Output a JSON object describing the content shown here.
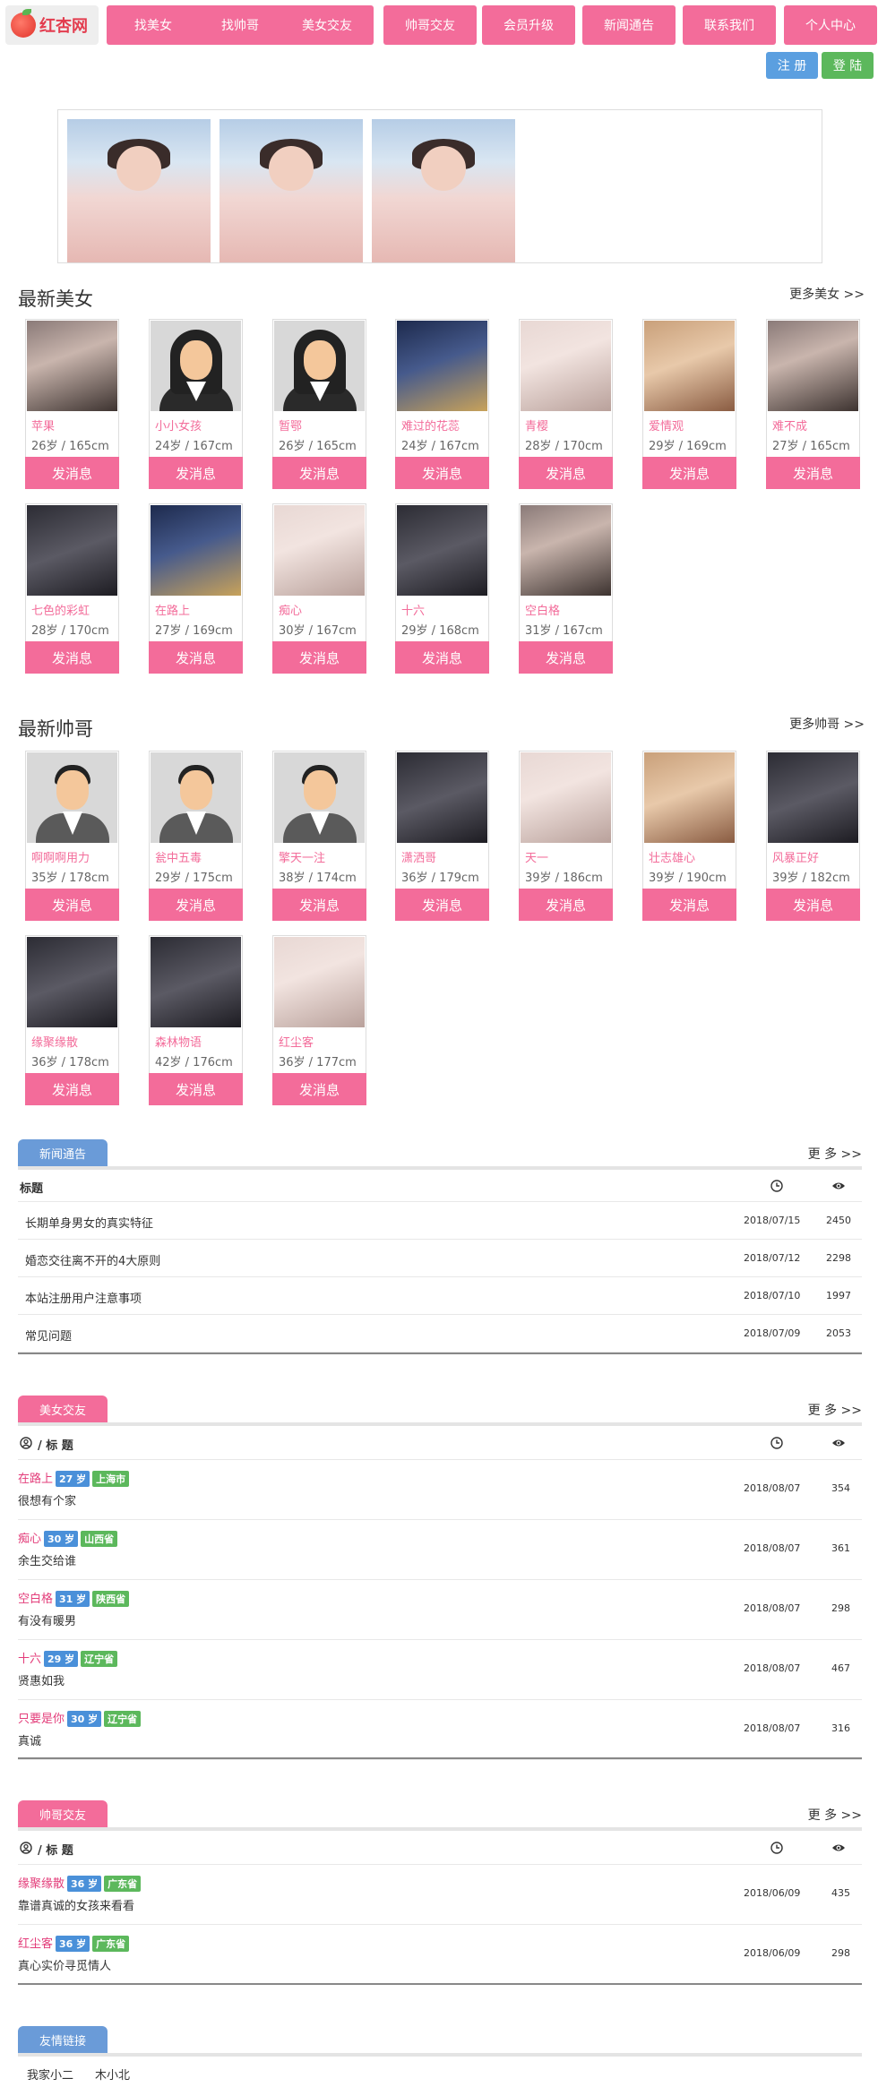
{
  "logo": {
    "text": "红杏网"
  },
  "nav": [
    "找美女",
    "找帅哥",
    "美女交友",
    "帅哥交友",
    "会员升级",
    "新闻通告",
    "联系我们",
    "个人中心"
  ],
  "auth": {
    "register": "注 册",
    "login": "登 陆"
  },
  "sections": {
    "girls": {
      "title": "最新美女",
      "more": "更多美女 >>"
    },
    "boys": {
      "title": "最新帅哥",
      "more": "更多帅哥 >>"
    }
  },
  "msg_label": "发消息",
  "girls": [
    {
      "name": "苹果",
      "info": "26岁 / 165cm",
      "photo": "photo"
    },
    {
      "name": "小小女孩",
      "info": "24岁 / 167cm",
      "photo": "avatar-f"
    },
    {
      "name": "暂鄂",
      "info": "26岁 / 165cm",
      "photo": "avatar-f"
    },
    {
      "name": "难过的花蕊",
      "info": "24岁 / 167cm",
      "photo": "blue"
    },
    {
      "name": "青樱",
      "info": "28岁 / 170cm",
      "photo": "light"
    },
    {
      "name": "爱情观",
      "info": "29岁 / 169cm",
      "photo": "warm"
    },
    {
      "name": "难不成",
      "info": "27岁 / 165cm",
      "photo": "photo"
    },
    {
      "name": "七色的彩虹",
      "info": "28岁 / 170cm",
      "photo": "dark"
    },
    {
      "name": "在路上",
      "info": "27岁 / 169cm",
      "photo": "blue"
    },
    {
      "name": "痴心",
      "info": "30岁 / 167cm",
      "photo": "light"
    },
    {
      "name": "十六",
      "info": "29岁 / 168cm",
      "photo": "dark"
    },
    {
      "name": "空白格",
      "info": "31岁 / 167cm",
      "photo": "photo"
    }
  ],
  "boys": [
    {
      "name": "啊啊啊用力",
      "info": "35岁 / 178cm",
      "photo": "avatar-m"
    },
    {
      "name": "瓮中五毒",
      "info": "29岁 / 175cm",
      "photo": "avatar-m"
    },
    {
      "name": "擎天一注",
      "info": "38岁 / 174cm",
      "photo": "avatar-m"
    },
    {
      "name": "潇洒哥",
      "info": "36岁 / 179cm",
      "photo": "dark"
    },
    {
      "name": "天一",
      "info": "39岁 / 186cm",
      "photo": "light"
    },
    {
      "name": "壮志雄心",
      "info": "39岁 / 190cm",
      "photo": "warm"
    },
    {
      "name": "风暴正好",
      "info": "39岁 / 182cm",
      "photo": "dark"
    },
    {
      "name": "缘聚缘散",
      "info": "36岁 / 178cm",
      "photo": "dark"
    },
    {
      "name": "森林物语",
      "info": "42岁 / 176cm",
      "photo": "dark"
    },
    {
      "name": "红尘客",
      "info": "36岁 / 177cm",
      "photo": "light"
    }
  ],
  "news": {
    "tab": "新闻通告",
    "more": "更 多 >>",
    "header": "标题",
    "rows": [
      {
        "title": "长期单身男女的真实特征",
        "date": "2018/07/15",
        "views": "2450"
      },
      {
        "title": "婚恋交往离不开的4大原则",
        "date": "2018/07/12",
        "views": "2298"
      },
      {
        "title": "本站注册用户注意事项",
        "date": "2018/07/10",
        "views": "1997"
      },
      {
        "title": "常见问题",
        "date": "2018/07/09",
        "views": "2053"
      }
    ]
  },
  "girl_posts": {
    "tab": "美女交友",
    "more": "更 多 >>",
    "header": "/ 标 题",
    "rows": [
      {
        "name": "在路上",
        "age": "27 岁",
        "prov": "上海市",
        "title": "很想有个家",
        "date": "2018/08/07",
        "views": "354"
      },
      {
        "name": "痴心",
        "age": "30 岁",
        "prov": "山西省",
        "title": "余生交给谁",
        "date": "2018/08/07",
        "views": "361"
      },
      {
        "name": "空白格",
        "age": "31 岁",
        "prov": "陕西省",
        "title": "有没有暖男",
        "date": "2018/08/07",
        "views": "298"
      },
      {
        "name": "十六",
        "age": "29 岁",
        "prov": "辽宁省",
        "title": "贤惠如我",
        "date": "2018/08/07",
        "views": "467"
      },
      {
        "name": "只要是你",
        "age": "30 岁",
        "prov": "辽宁省",
        "title": "真诚",
        "date": "2018/08/07",
        "views": "316"
      }
    ]
  },
  "boy_posts": {
    "tab": "帅哥交友",
    "more": "更 多 >>",
    "header": "/ 标 题",
    "rows": [
      {
        "name": "缘聚缘散",
        "age": "36 岁",
        "prov": "广东省",
        "title": "靠谱真诚的女孩来看看",
        "date": "2018/06/09",
        "views": "435"
      },
      {
        "name": "红尘客",
        "age": "36 岁",
        "prov": "广东省",
        "title": "真心实价寻觅情人",
        "date": "2018/06/09",
        "views": "298"
      }
    ]
  },
  "links": {
    "tab": "友情链接",
    "items": [
      "我家小二",
      "木小北"
    ]
  }
}
